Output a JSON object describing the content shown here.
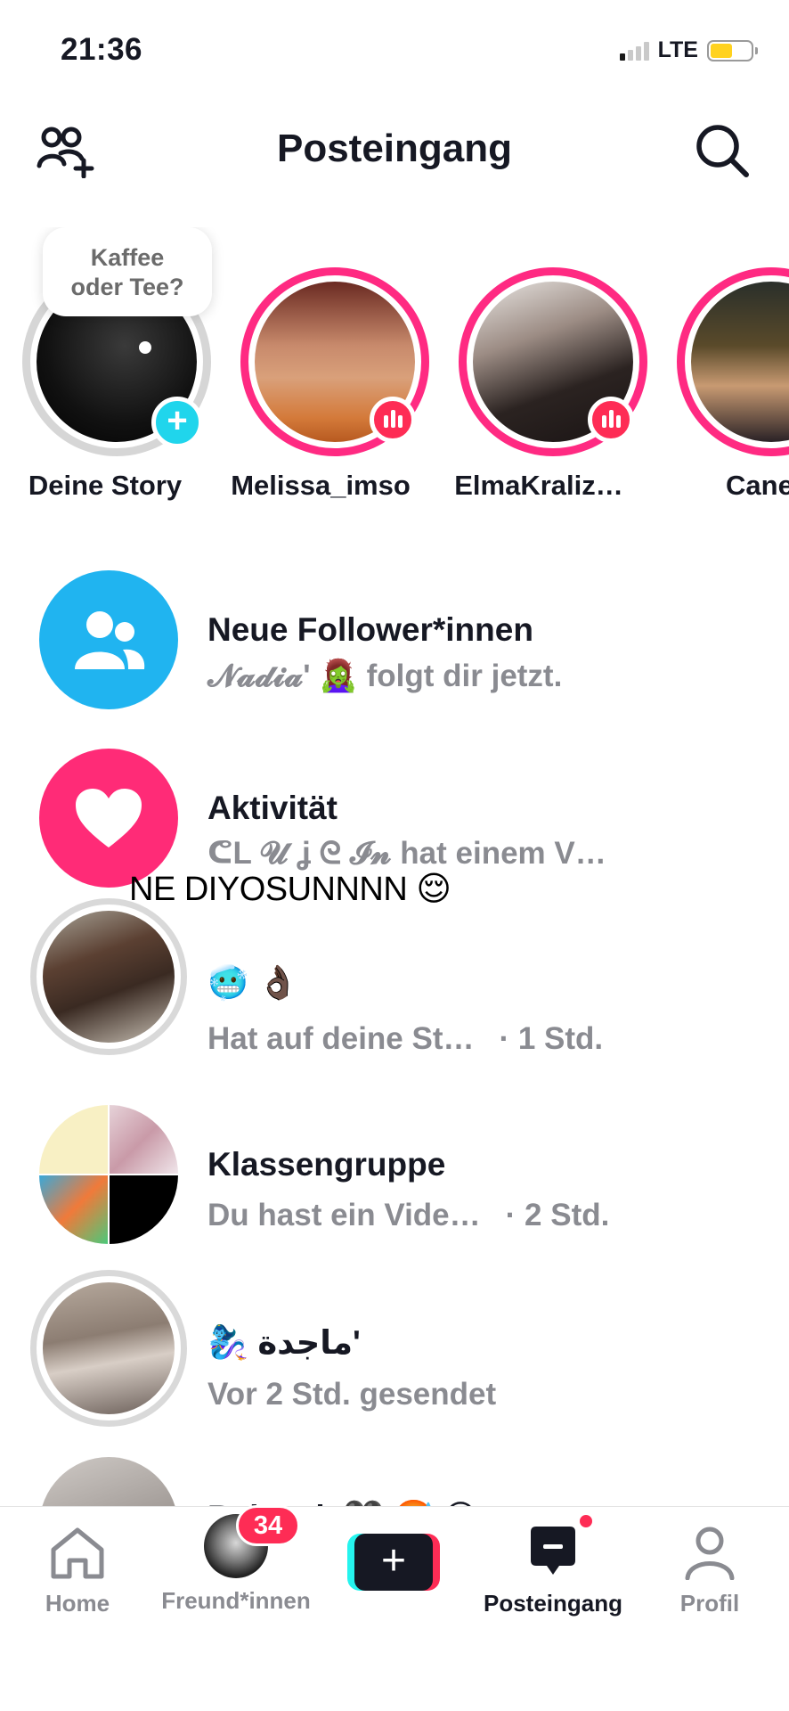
{
  "status_bar": {
    "time": "21:36",
    "network": "LTE",
    "battery_level": 0.55
  },
  "header": {
    "title": "Posteingang",
    "left_icon": "add-friends-icon",
    "right_icon": "search-icon"
  },
  "stories": {
    "bubble_text": "Kaffee\noder Tee?",
    "items": [
      {
        "name": "Deine Story",
        "badge": "plus"
      },
      {
        "name": "Melissa_imso",
        "badge": "live"
      },
      {
        "name": "ElmaKraliz…",
        "badge": "live"
      },
      {
        "name": "Cane",
        "badge": "none"
      }
    ]
  },
  "caption_overlay": "NE DIYOSUNNNN 😌",
  "inbox": [
    {
      "title": "Neue Follower*innen",
      "subtitle": "𝓝𝓪𝓭𝓲𝓪ʹ 🧟‍♀️ folgt dir jetzt.",
      "time": "",
      "icon": "followers-icon",
      "color": "#20b4f0"
    },
    {
      "title": "Aktivität",
      "subtitle": "ᕦL 𝓤 ʝ ᘓ 𝓘𝓷 hat einem V…",
      "time": "",
      "icon": "heart-icon",
      "color": "#ff2b77"
    },
    {
      "title": "🥶 👌🏿",
      "subtitle": "Hat auf deine St…",
      "time": "· 1 Std."
    },
    {
      "title": "Klassengruppe",
      "subtitle": "Du hast ein Vide…",
      "time": "· 2 Std."
    },
    {
      "title": "🧞‍♀️ ماجدة'",
      "subtitle": "Vor 2 Std. gesendet",
      "time": ""
    },
    {
      "title": "Babacık 🖤 🥵 😎",
      "subtitle": "",
      "time": ""
    }
  ],
  "tabbar": {
    "home": "Home",
    "friends": "Freund*innen",
    "friends_count": "34",
    "inbox": "Posteingang",
    "profile": "Profil"
  }
}
